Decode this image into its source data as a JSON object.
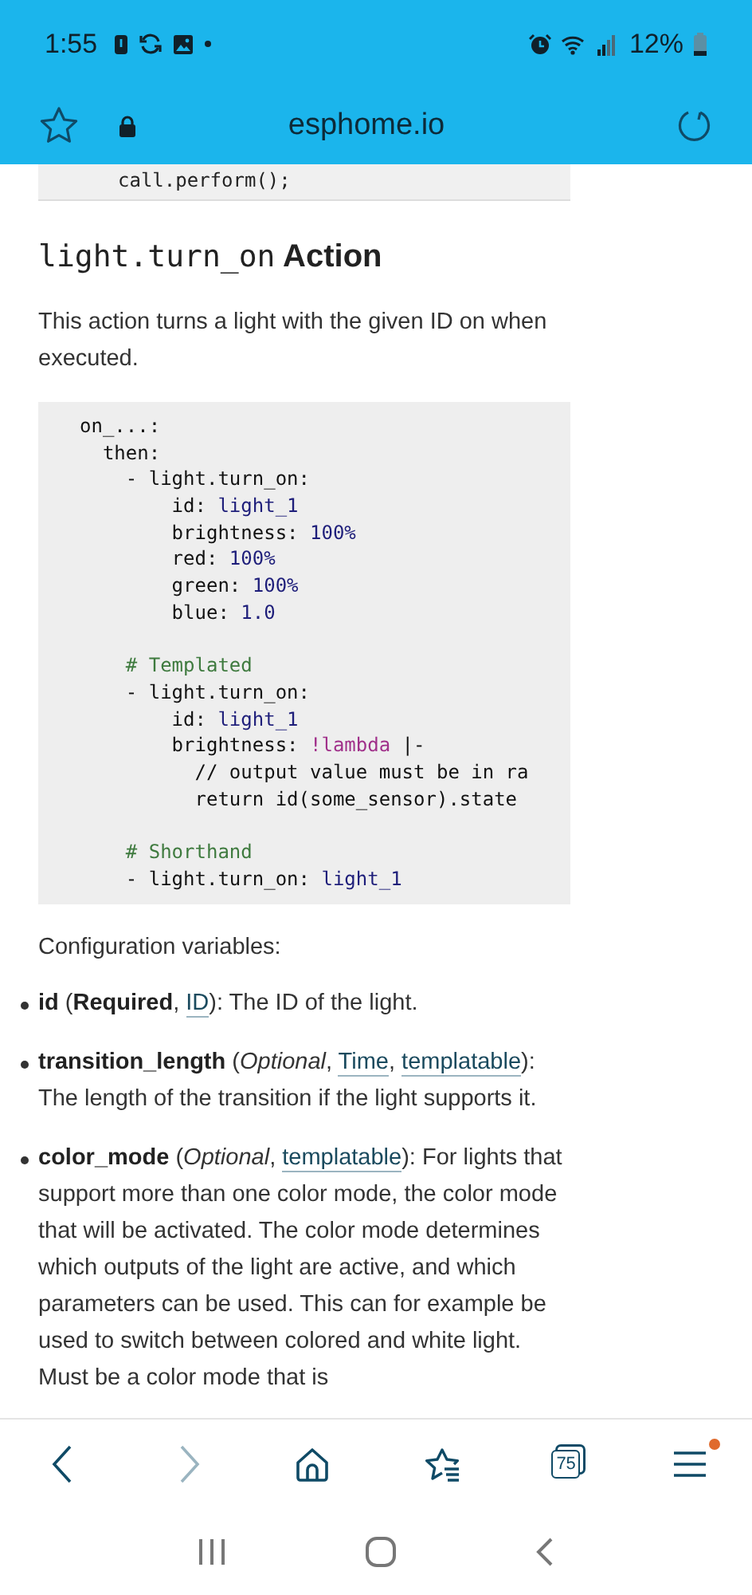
{
  "status_bar": {
    "time": "1:55",
    "battery": "12%"
  },
  "address_bar": {
    "url": "esphome.io"
  },
  "code_above": "call.perform();",
  "heading": {
    "code": "light.turn_on",
    "text": "Action"
  },
  "intro": "This action turns a light with the given ID on when executed.",
  "code": [
    [
      [
        {
          "kind": "plain",
          "text": "on_...:"
        }
      ],
      [
        {
          "kind": "plain",
          "text": "  then:"
        }
      ],
      [
        {
          "kind": "plain",
          "text": "    - light.turn_on:"
        }
      ],
      [
        {
          "kind": "plain",
          "text": "        id: "
        },
        {
          "kind": "value",
          "text": "light_1"
        }
      ],
      [
        {
          "kind": "plain",
          "text": "        brightness: "
        },
        {
          "kind": "value",
          "text": "100%"
        }
      ],
      [
        {
          "kind": "plain",
          "text": "        red: "
        },
        {
          "kind": "value",
          "text": "100%"
        }
      ],
      [
        {
          "kind": "plain",
          "text": "        green: "
        },
        {
          "kind": "value",
          "text": "100%"
        }
      ],
      [
        {
          "kind": "plain",
          "text": "        blue: "
        },
        {
          "kind": "value",
          "text": "1.0"
        }
      ]
    ],
    [
      [
        {
          "kind": "comment",
          "text": "    # Templated"
        }
      ],
      [
        {
          "kind": "plain",
          "text": "    - light.turn_on:"
        }
      ],
      [
        {
          "kind": "plain",
          "text": "        id: "
        },
        {
          "kind": "value",
          "text": "light_1"
        }
      ],
      [
        {
          "kind": "plain",
          "text": "        brightness: "
        },
        {
          "kind": "tag",
          "text": "!lambda"
        },
        {
          "kind": "plain",
          "text": " |-"
        }
      ],
      [
        {
          "kind": "plain",
          "text": "          // output value must be in ra"
        }
      ],
      [
        {
          "kind": "plain",
          "text": "          return id(some_sensor).state"
        }
      ]
    ],
    [
      [
        {
          "kind": "comment",
          "text": "    # Shorthand"
        }
      ],
      [
        {
          "kind": "plain",
          "text": "    - light.turn_on: "
        },
        {
          "kind": "value",
          "text": "light_1"
        }
      ]
    ]
  ],
  "config_title": "Configuration variables:",
  "params": [
    [
      {
        "kind": "bold",
        "text": "id"
      },
      {
        "kind": "plain",
        "text": " ("
      },
      {
        "kind": "bold",
        "text": "Required"
      },
      {
        "kind": "plain",
        "text": ", "
      },
      {
        "kind": "link",
        "text": "ID"
      },
      {
        "kind": "plain",
        "text": "): The ID of the light."
      }
    ],
    [
      {
        "kind": "bold",
        "text": "transition_length"
      },
      {
        "kind": "plain",
        "text": " ("
      },
      {
        "kind": "italic",
        "text": "Optional"
      },
      {
        "kind": "plain",
        "text": ", "
      },
      {
        "kind": "link",
        "text": "Time"
      },
      {
        "kind": "plain",
        "text": ", "
      },
      {
        "kind": "link",
        "text": "templatable"
      },
      {
        "kind": "plain",
        "text": "): The length of the transition if the light supports it."
      }
    ],
    [
      {
        "kind": "bold",
        "text": "color_mode"
      },
      {
        "kind": "plain",
        "text": " ("
      },
      {
        "kind": "italic",
        "text": "Optional"
      },
      {
        "kind": "plain",
        "text": ", "
      },
      {
        "kind": "link",
        "text": "templatable"
      },
      {
        "kind": "plain",
        "text": "): For lights that support more than one color mode, the color mode that will be activated. The color mode determines which outputs of the light are active, and which parameters can be used. This can for example be used to switch between colored and white light. Must be a color mode that is"
      }
    ]
  ],
  "toolbar": {
    "back_disabled": false,
    "forward_disabled": true,
    "tab_count": "75",
    "menu_badge": true
  }
}
